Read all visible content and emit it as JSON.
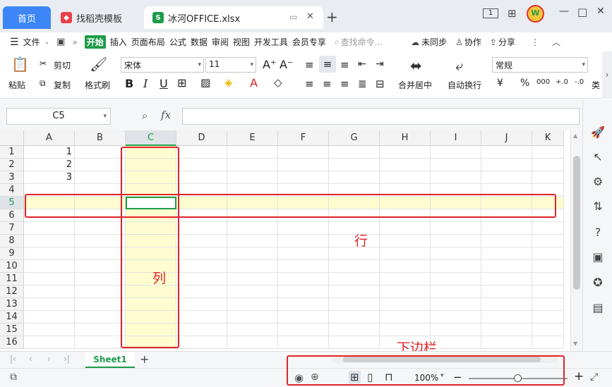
{
  "title_bar": {
    "tabs": [
      {
        "label": "首页"
      },
      {
        "label": "找稻壳模板"
      },
      {
        "label": "冰河OFFICE.xlsx"
      }
    ],
    "new_tab": "+",
    "view_badge": "1",
    "controls": [
      "—",
      "□",
      "✕"
    ]
  },
  "menu": {
    "file": "文件",
    "more": "»",
    "items": [
      "开始",
      "插入",
      "页面布局",
      "公式",
      "数据",
      "审阅",
      "视图",
      "开发工具",
      "会员专享"
    ],
    "search_placeholder": "查找命令...",
    "sync": "未同步",
    "collab": "协作",
    "share": "分享"
  },
  "ribbon": {
    "paste": "粘贴",
    "cut": "剪切",
    "copy": "复制",
    "format_painter": "格式刷",
    "font": "宋体",
    "size": "11",
    "merge": "合并居中",
    "wrap": "自动换行",
    "number_format": "常规",
    "currency": "¥",
    "percent": "%",
    "thousand": "000",
    "inc_dec": "+.0",
    "dec_dec": "-.0",
    "type_label": "类"
  },
  "formula_bar": {
    "name_box": "C5",
    "fx": "fx"
  },
  "columns": [
    "A",
    "B",
    "C",
    "D",
    "E",
    "F",
    "G",
    "H",
    "I",
    "J",
    "K"
  ],
  "rows": [
    "1",
    "2",
    "3",
    "4",
    "5",
    "6",
    "7",
    "8",
    "9",
    "10",
    "11",
    "12",
    "13",
    "14",
    "15",
    "16"
  ],
  "cells": {
    "A1": "1",
    "A2": "2",
    "A3": "3"
  },
  "annotations": {
    "row": "行",
    "col": "列",
    "bottom_bar": "下边栏"
  },
  "sheet_tabs": {
    "active": "Sheet1",
    "add": "+"
  },
  "status": {
    "zoom": "100%",
    "zoom_minus": "−",
    "zoom_plus": "+",
    "zoom_level": 0.5
  },
  "colors": {
    "accent": "#3c86f7",
    "green_active": "#1d9c4a",
    "highlight": "#fffdd0",
    "annotation": "#e0242b"
  }
}
